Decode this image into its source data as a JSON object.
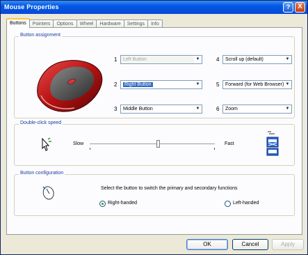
{
  "window": {
    "title": "Mouse Properties"
  },
  "title_buttons": {
    "help": "?",
    "close": "X"
  },
  "tabs": [
    {
      "label": "Buttons",
      "active": true
    },
    {
      "label": "Pointers"
    },
    {
      "label": "Options"
    },
    {
      "label": "Wheel"
    },
    {
      "label": "Hardware"
    },
    {
      "label": "Settings"
    },
    {
      "label": "Info"
    }
  ],
  "button_assignment": {
    "group_label": "Button assignment",
    "rows": [
      {
        "num": "1",
        "value": "Left Button",
        "disabled": true
      },
      {
        "num": "2",
        "value": "Right Button",
        "selected": true
      },
      {
        "num": "3",
        "value": "Middle Button"
      },
      {
        "num": "4",
        "value": "Scroll up (default)"
      },
      {
        "num": "5",
        "value": "Forward (for Web Browser)"
      },
      {
        "num": "6",
        "value": "Zoom"
      }
    ]
  },
  "double_click": {
    "group_label": "Double-click speed",
    "slow": "Slow",
    "fast": "Fast",
    "level_fraction": 0.55
  },
  "button_config": {
    "group_label": "Button configuration",
    "description": "Select the button to switch the primary and secondary functions",
    "right_hand": "Right-handed",
    "left_hand": "Left-handed",
    "selected": "right"
  },
  "footer": {
    "ok": "OK",
    "cancel": "Cancel",
    "apply": "Apply"
  },
  "colors": {
    "accent": "#316ac5",
    "titlebar": "#0058e6",
    "mouse_red": "#c41a1a"
  },
  "icons": [
    "help-icon",
    "close-icon",
    "mouse-icon",
    "pointer-icon",
    "folder-icon"
  ]
}
